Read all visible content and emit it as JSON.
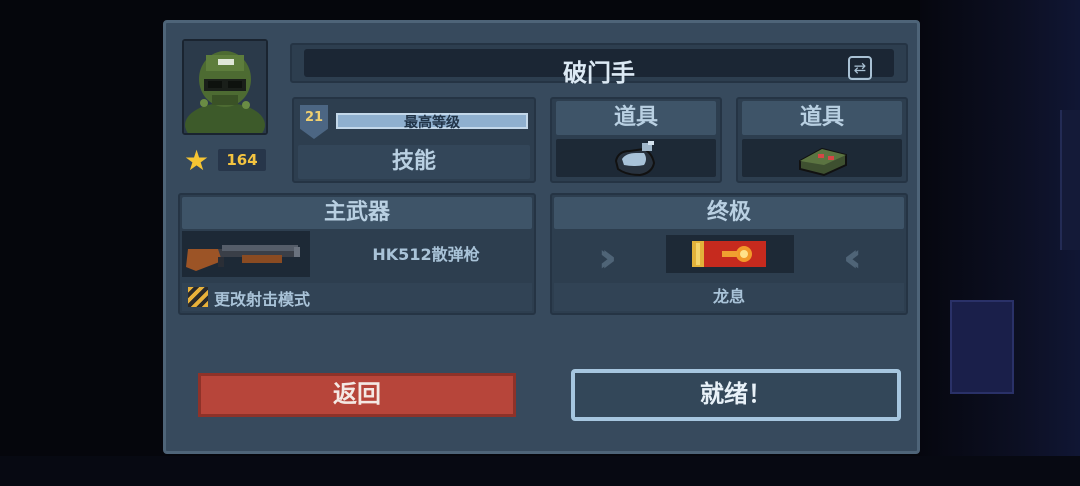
{
  "character": {
    "name": "破门手",
    "stars": "164",
    "level": "21",
    "level_label": "最高等级",
    "skill_label": "技能"
  },
  "items": [
    {
      "title": "道具",
      "icon": "grenade-icon"
    },
    {
      "title": "道具",
      "icon": "mine-icon"
    }
  ],
  "primary_weapon": {
    "title": "主武器",
    "name": "HK512散弹枪",
    "fire_mode_label": "更改射击模式",
    "icon": "shotgun-icon"
  },
  "ultimate": {
    "title": "终极",
    "name": "龙息",
    "icon": "dragon-breath-shell-icon"
  },
  "buttons": {
    "back": "返回",
    "ready": "就绪！"
  },
  "colors": {
    "panel": "#374a5d",
    "back_button": "#b7453a",
    "ready_border": "#a6c6df",
    "star": "#f6c533"
  }
}
